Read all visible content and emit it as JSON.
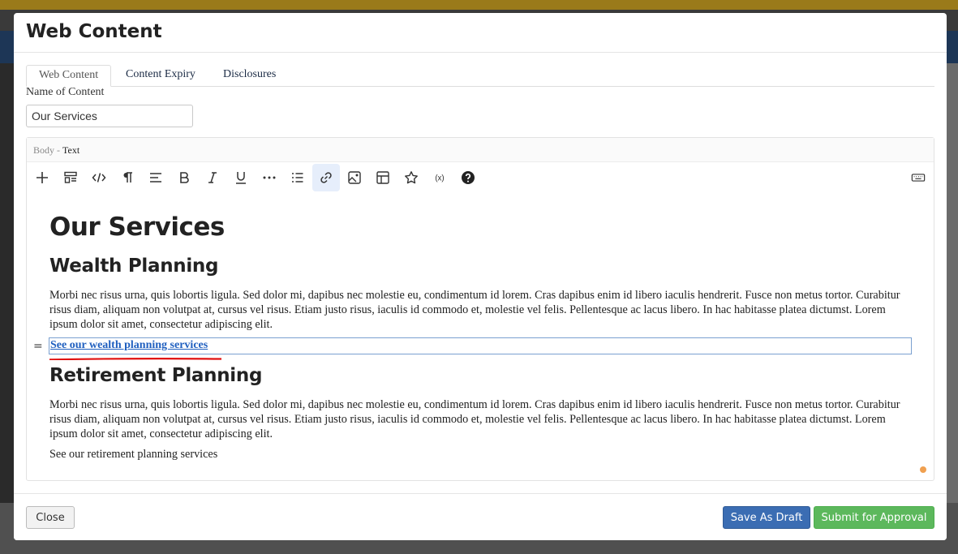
{
  "modal": {
    "title": "Web Content"
  },
  "tabs": [
    {
      "label": "Web Content",
      "active": true
    },
    {
      "label": "Content Expiry",
      "active": false
    },
    {
      "label": "Disclosures",
      "active": false
    }
  ],
  "name_field": {
    "label": "Name of Content",
    "value": "Our Services"
  },
  "editor": {
    "label_prefix": "Body -",
    "label_type": "Text",
    "toolbar": [
      {
        "icon": "plus-icon"
      },
      {
        "icon": "block-format-icon"
      },
      {
        "icon": "code-icon"
      },
      {
        "icon": "paragraph-icon"
      },
      {
        "icon": "align-left-icon"
      },
      {
        "icon": "bold-icon"
      },
      {
        "icon": "italic-icon"
      },
      {
        "icon": "underline-icon"
      },
      {
        "icon": "more-icon"
      },
      {
        "icon": "list-icon"
      },
      {
        "icon": "link-icon",
        "active": true
      },
      {
        "icon": "image-icon"
      },
      {
        "icon": "table-icon"
      },
      {
        "icon": "star-icon"
      },
      {
        "icon": "variable-icon"
      },
      {
        "icon": "help-icon"
      },
      {
        "icon": "keyboard-icon"
      }
    ],
    "content": {
      "heading": "Our Services",
      "section1_heading": "Wealth Planning",
      "section1_text": "Morbi nec risus urna, quis lobortis ligula. Sed dolor mi, dapibus nec molestie eu, condimentum id lorem. Cras dapibus enim id libero iaculis hendrerit. Fusce non metus tortor. Curabitur risus diam, aliquam non volutpat at, cursus vel risus. Etiam justo risus, iaculis id commodo et, molestie vel felis. Pellentesque ac lacus libero. In hac habitasse platea dictumst. Lorem ipsum dolor sit amet, consectetur adipiscing elit.",
      "section1_link": "See our wealth planning services",
      "drag_handle": "=",
      "section2_heading": "Retirement Planning",
      "section2_text": "Morbi nec risus urna, quis lobortis ligula. Sed dolor mi, dapibus nec molestie eu, condimentum id lorem. Cras dapibus enim id libero iaculis hendrerit. Fusce non metus tortor. Curabitur risus diam, aliquam non volutpat at, cursus vel risus. Etiam justo risus, iaculis id commodo et, molestie vel felis. Pellentesque ac lacus libero. In hac habitasse platea dictumst. Lorem ipsum dolor sit amet, consectetur adipiscing elit.",
      "section2_link": "See our retirement planning services"
    }
  },
  "footer": {
    "close_label": "Close",
    "draft_label": "Save As Draft",
    "submit_label": "Submit for Approval"
  },
  "colors": {
    "accent_blue": "#3b6db3",
    "submit_green": "#5cb85c",
    "link_blue": "#1f5fbf",
    "highlight_red": "#e01010",
    "status_orange": "#f0a050"
  }
}
